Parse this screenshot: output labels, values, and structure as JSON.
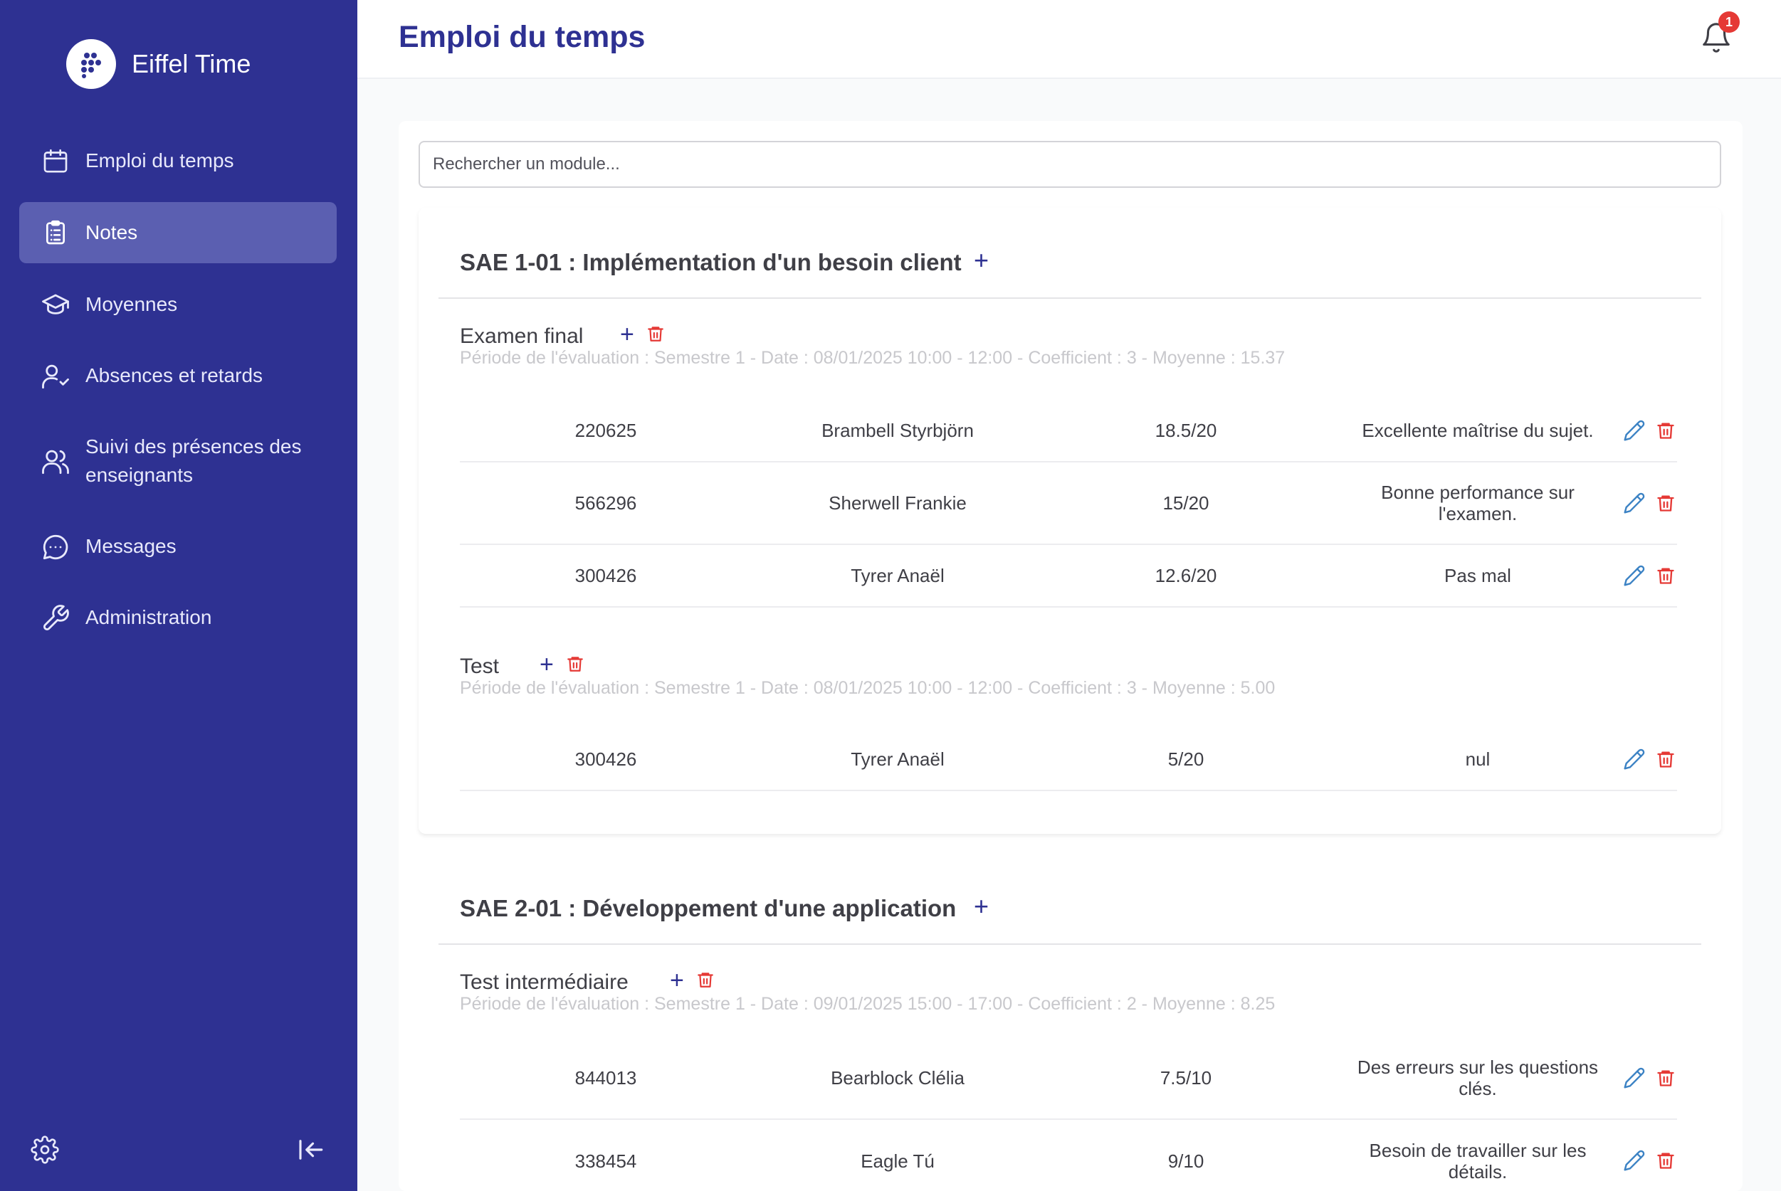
{
  "app": {
    "name": "Eiffel Time"
  },
  "header": {
    "title": "Emploi du temps",
    "notification_count": "1"
  },
  "sidebar": {
    "items": [
      {
        "label": "Emploi du temps",
        "icon": "calendar-icon"
      },
      {
        "label": "Notes",
        "icon": "clipboard-list-icon",
        "active": true
      },
      {
        "label": "Moyennes",
        "icon": "graduation-cap-icon"
      },
      {
        "label": "Absences et retards",
        "icon": "user-check-icon"
      },
      {
        "label": "Suivi des présences des enseignants",
        "icon": "users-icon"
      },
      {
        "label": "Messages",
        "icon": "message-circle-icon"
      },
      {
        "label": "Administration",
        "icon": "wrench-icon"
      }
    ],
    "bottom": {
      "settings_icon": "gear-icon",
      "collapse_icon": "collapse-left-icon"
    }
  },
  "search": {
    "placeholder": "Rechercher un module..."
  },
  "modules": [
    {
      "title": "SAE 1-01 : Implémentation d'un besoin client",
      "evaluations": [
        {
          "title": "Examen final",
          "meta": "Période de l'évaluation : Semestre 1 - Date : 08/01/2025 10:00 - 12:00 - Coefficient : 3  - Moyenne : 15.37",
          "rows": [
            {
              "id": "220625",
              "name": "Brambell Styrbjörn",
              "note": "18.5/20",
              "comment": "Excellente maîtrise du sujet."
            },
            {
              "id": "566296",
              "name": "Sherwell Frankie",
              "note": "15/20",
              "comment": "Bonne performance sur l'examen."
            },
            {
              "id": "300426",
              "name": "Tyrer Anaël",
              "note": "12.6/20",
              "comment": "Pas mal"
            }
          ]
        },
        {
          "title": "Test",
          "meta": "Période de l'évaluation : Semestre 1 - Date : 08/01/2025 10:00 - 12:00 - Coefficient : 3  - Moyenne : 5.00",
          "rows": [
            {
              "id": "300426",
              "name": "Tyrer Anaël",
              "note": "5/20",
              "comment": "nul"
            }
          ]
        }
      ]
    },
    {
      "title": "SAE 2-01 : Développement d'une application",
      "evaluations": [
        {
          "title": "Test intermédiaire",
          "meta": "Période de l'évaluation : Semestre 1 - Date : 09/01/2025 15:00 - 17:00 - Coefficient : 2  - Moyenne : 8.25",
          "rows": [
            {
              "id": "844013",
              "name": "Bearblock Clélia",
              "note": "7.5/10",
              "comment": "Des erreurs sur les questions clés."
            },
            {
              "id": "338454",
              "name": "Eagle Tú",
              "note": "9/10",
              "comment": "Besoin de travailler sur les détails."
            }
          ]
        }
      ]
    }
  ],
  "colors": {
    "sidebar": "#2e3192",
    "active_item": "#5b5fb1",
    "accent": "#2e3192",
    "delete": "#e53935",
    "edit": "#3b82c4"
  }
}
